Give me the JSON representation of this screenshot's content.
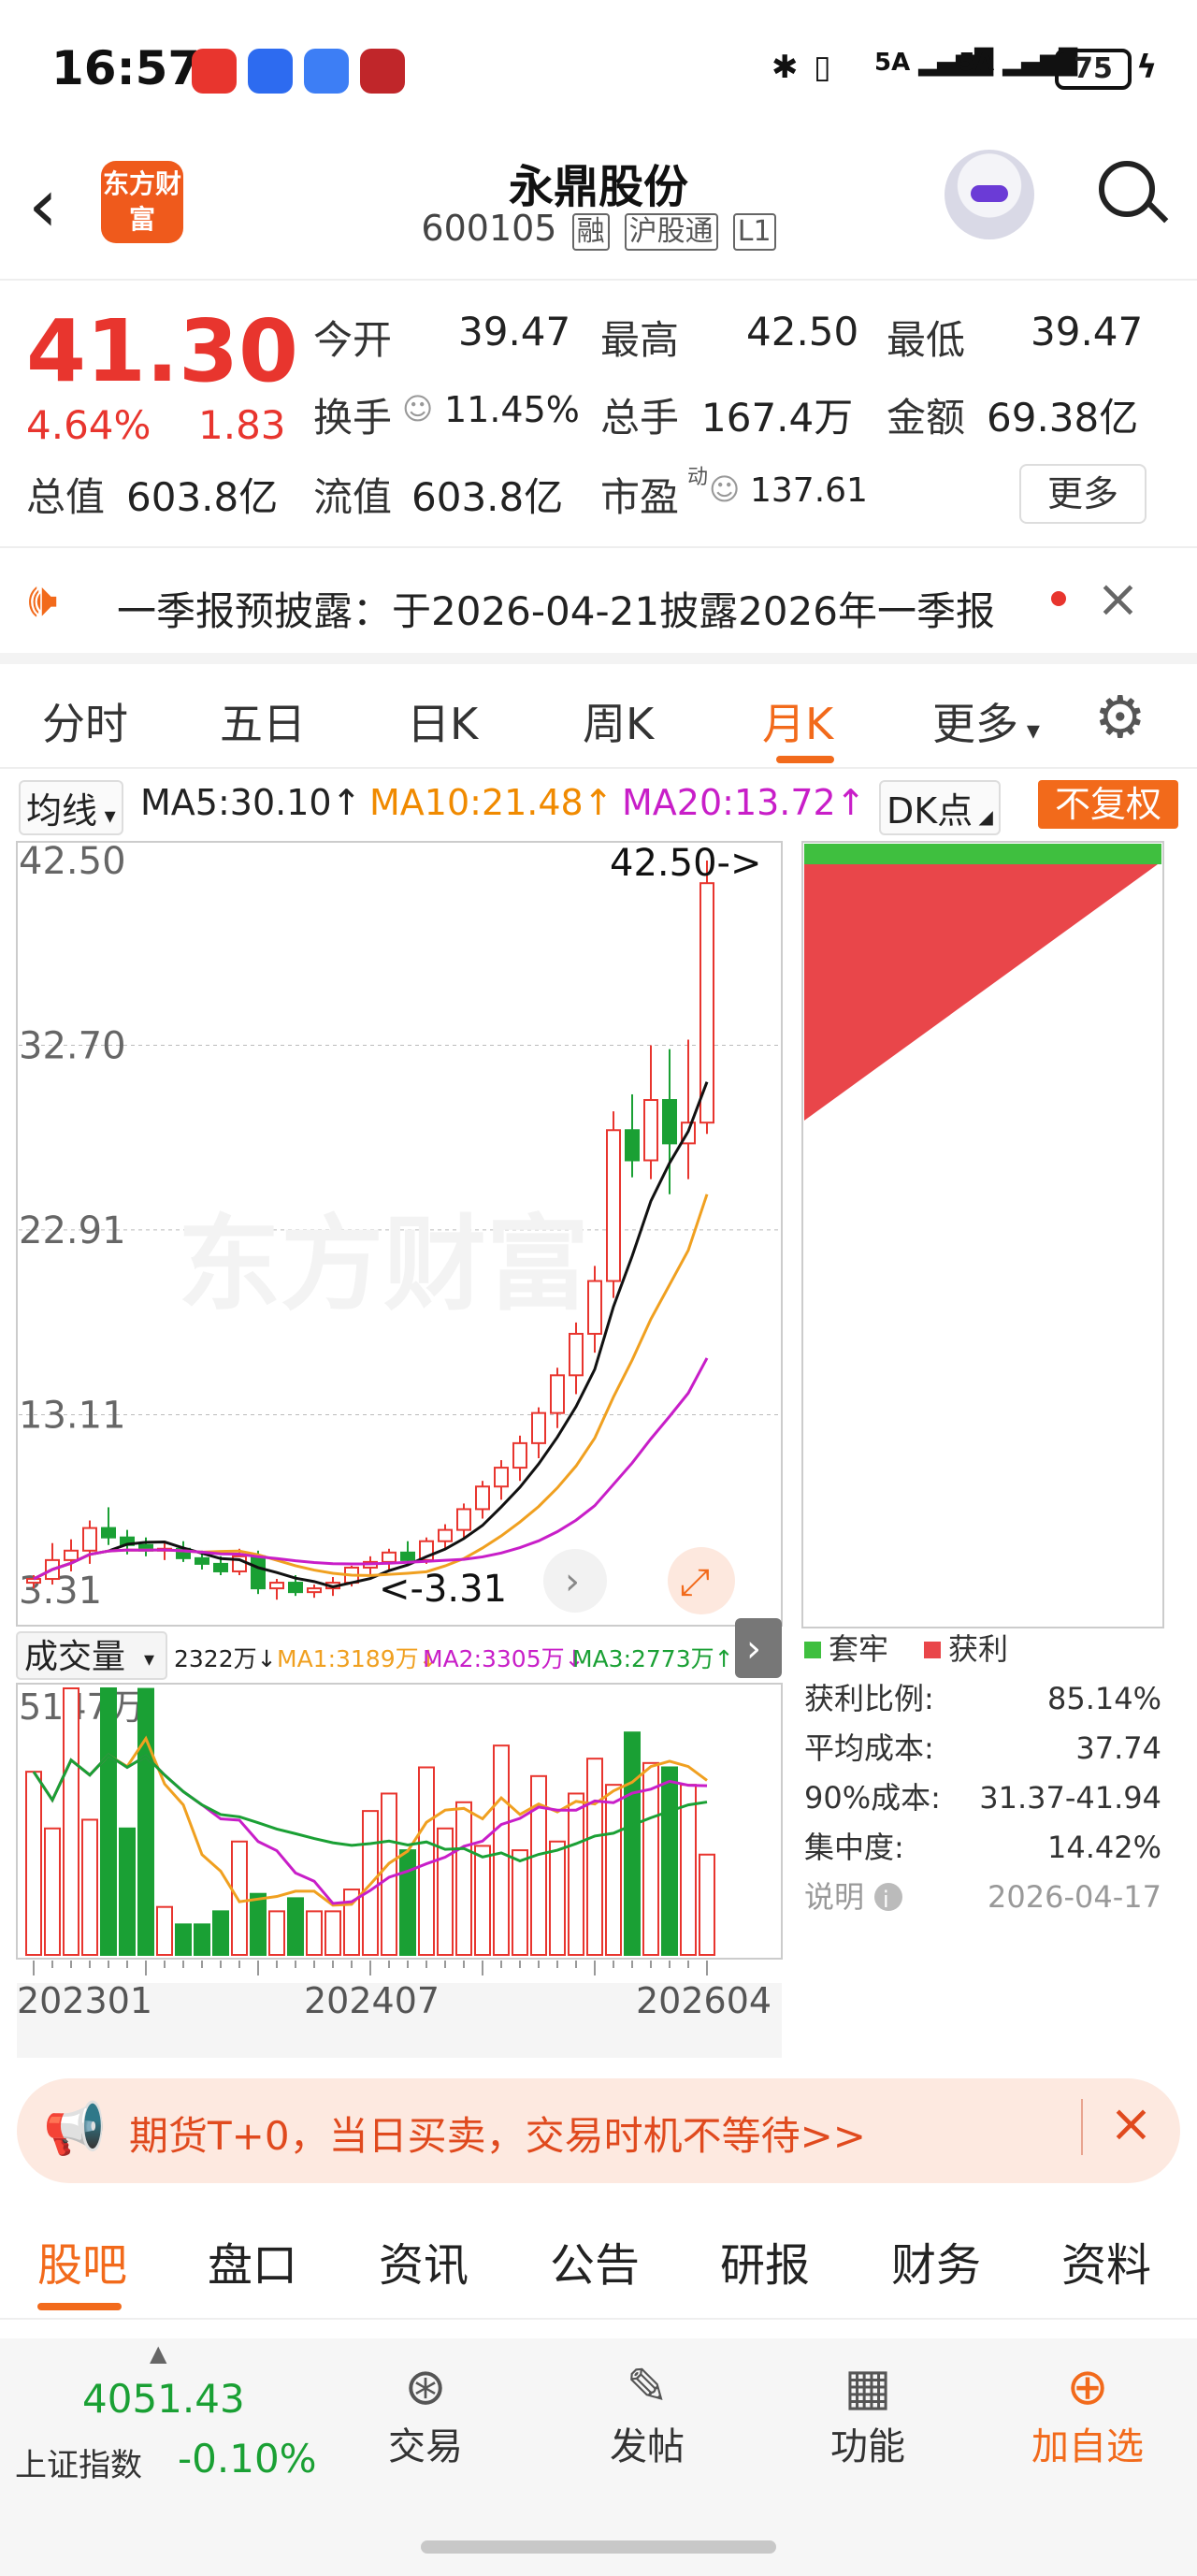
{
  "status_bar": {
    "time": "16:57",
    "network": "5A",
    "battery": "75"
  },
  "header": {
    "title": "永鼎股份",
    "code": "600105",
    "tags": [
      "融",
      "沪股通",
      "L1"
    ],
    "logo_text": "东方财富"
  },
  "quote": {
    "price": "41.30",
    "change_pct": "4.64%",
    "change_amt": "1.83",
    "open_label": "今开",
    "open": "39.47",
    "high_label": "最高",
    "high": "42.50",
    "low_label": "最低",
    "low": "39.47",
    "turnover_label": "换手",
    "turnover": "11.45%",
    "volume_label": "总手",
    "volume": "167.4万",
    "amount_label": "金额",
    "amount": "69.38亿",
    "mcap_label": "总值",
    "mcap": "603.8亿",
    "float_label": "流值",
    "float_cap": "603.8亿",
    "pe_label": "市盈",
    "pe_sup": "动",
    "pe": "137.61",
    "more_button": "更多"
  },
  "notice": {
    "text": "一季报预披露：于2026-04-21披露2026年一季报"
  },
  "period_tabs": [
    "分时",
    "五日",
    "日K",
    "周K",
    "月K",
    "更多"
  ],
  "active_period": "月K",
  "ma_bar": {
    "selector": "均线",
    "ma5": "MA5:30.10↑",
    "ma10": "MA10:21.48↑",
    "ma20": "MA20:13.72↑",
    "dk": "DK点",
    "fuquan": "不复权"
  },
  "kline": {
    "y_labels": [
      "42.50",
      "32.70",
      "22.91",
      "13.11",
      "3.31"
    ],
    "high_marker": "42.50->",
    "low_marker": "<-3.31",
    "watermark": "东方财富"
  },
  "volume": {
    "selector": "成交量",
    "current": "2322万↓",
    "ma1": "MA1:3189万↓",
    "ma2": "MA2:3305万↓",
    "ma3": "MA3:2773万↑",
    "max_label": "5147万",
    "x_labels": [
      "202301",
      "202407",
      "202604"
    ]
  },
  "chip": {
    "legend_trapped": "套牢",
    "legend_profit": "获利",
    "rows": [
      {
        "label": "获利比例:",
        "value": "85.14%"
      },
      {
        "label": "平均成本:",
        "value": "37.74"
      },
      {
        "label": "90%成本:",
        "value": "31.37-41.94"
      },
      {
        "label": "集中度:",
        "value": "14.42%"
      }
    ],
    "note_label": "说明",
    "date": "2026-04-17"
  },
  "ad": {
    "text": "期货T+0，当日买卖，交易时机不等待>>"
  },
  "bottom_tabs": [
    "股吧",
    "盘口",
    "资讯",
    "公告",
    "研报",
    "财务",
    "资料"
  ],
  "footer": {
    "index_value": "4051.43",
    "index_name": "上证指数",
    "index_change": "-0.10%",
    "items": [
      "交易",
      "发帖",
      "功能",
      "加自选"
    ]
  },
  "colors": {
    "up": "#e8352e",
    "down": "#1aa034",
    "accent": "#f26a1b",
    "ma10": "#f0a020",
    "ma20": "#c81ec8"
  },
  "chart_data": {
    "type": "candlestick",
    "title": "",
    "period": "月K",
    "price_range": [
      3.31,
      42.5
    ],
    "y_ticks": [
      42.5,
      32.7,
      22.91,
      13.11,
      3.31
    ],
    "candles": [
      [
        4.2,
        4.6,
        3.9,
        4.4
      ],
      [
        4.4,
        6.3,
        4.1,
        5.4
      ],
      [
        5.4,
        6.5,
        4.8,
        5.9
      ],
      [
        5.9,
        7.5,
        5.2,
        7.1
      ],
      [
        7.1,
        8.2,
        6.2,
        6.6
      ],
      [
        6.6,
        7.0,
        5.7,
        6.2
      ],
      [
        6.2,
        6.6,
        5.6,
        5.9
      ],
      [
        5.9,
        6.3,
        5.4,
        6.0
      ],
      [
        6.0,
        6.4,
        5.3,
        5.5
      ],
      [
        5.5,
        5.9,
        4.9,
        5.2
      ],
      [
        5.2,
        5.6,
        4.6,
        4.8
      ],
      [
        4.8,
        6.0,
        4.6,
        5.6
      ],
      [
        5.6,
        5.9,
        3.6,
        3.9
      ],
      [
        3.9,
        4.4,
        3.3,
        4.2
      ],
      [
        4.2,
        4.6,
        3.5,
        3.7
      ],
      [
        3.7,
        4.1,
        3.4,
        3.9
      ],
      [
        3.9,
        4.5,
        3.5,
        4.2
      ],
      [
        4.2,
        5.1,
        4.0,
        5.0
      ],
      [
        5.0,
        5.6,
        4.6,
        5.3
      ],
      [
        5.3,
        6.0,
        4.9,
        5.8
      ],
      [
        5.8,
        6.4,
        5.1,
        5.4
      ],
      [
        5.4,
        6.6,
        5.2,
        6.4
      ],
      [
        6.4,
        7.3,
        6.0,
        7.0
      ],
      [
        7.0,
        8.4,
        6.6,
        8.1
      ],
      [
        8.1,
        9.6,
        7.6,
        9.3
      ],
      [
        9.3,
        10.7,
        8.6,
        10.3
      ],
      [
        10.3,
        12.0,
        9.6,
        11.6
      ],
      [
        11.6,
        13.5,
        10.8,
        13.2
      ],
      [
        13.2,
        15.6,
        12.4,
        15.2
      ],
      [
        15.2,
        18.0,
        14.2,
        17.4
      ],
      [
        17.4,
        21.0,
        16.4,
        20.2
      ],
      [
        20.2,
        29.2,
        19.3,
        28.2
      ],
      [
        28.2,
        30.1,
        25.7,
        26.6
      ],
      [
        26.6,
        32.7,
        25.6,
        29.8
      ],
      [
        29.8,
        32.5,
        24.8,
        27.5
      ],
      [
        27.5,
        33.0,
        25.6,
        28.6
      ],
      [
        28.6,
        42.5,
        28.0,
        41.3
      ]
    ],
    "volume_unit": "万",
    "volume_max": 5147,
    "volumes": [
      4200,
      2900,
      6300,
      3100,
      6400,
      2900,
      6100,
      1100,
      700,
      700,
      1000,
      2600,
      1400,
      1000,
      1300,
      1000,
      1000,
      1500,
      3300,
      3700,
      2400,
      4300,
      2900,
      3500,
      2500,
      4800,
      2400,
      4100,
      2600,
      3700,
      4500,
      3900,
      5100,
      4400,
      4300,
      3900,
      2300
    ],
    "x_labels": [
      "202301",
      "202407",
      "202604"
    ]
  }
}
